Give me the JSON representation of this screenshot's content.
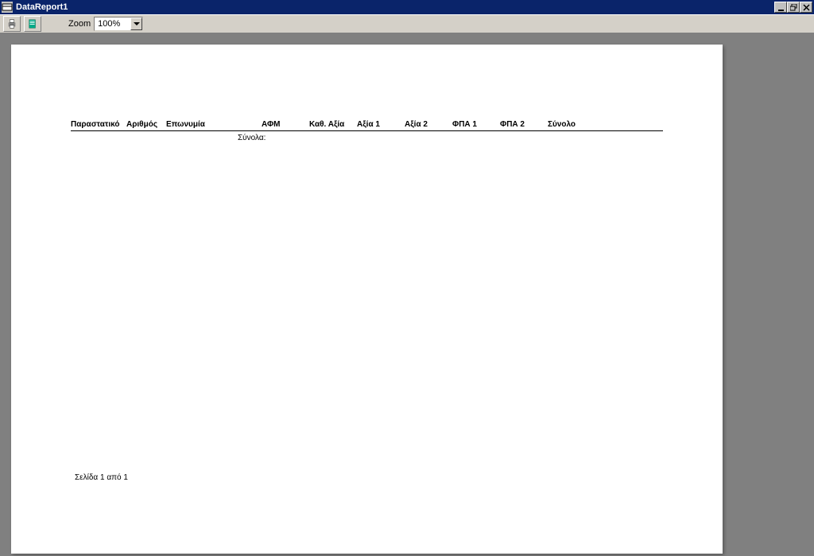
{
  "window": {
    "title": "DataReport1"
  },
  "toolbar": {
    "zoom_label": "Zoom",
    "zoom_value": "100%"
  },
  "report": {
    "columns": {
      "parastatiko": "Παραστατικό",
      "arithmos": "Αριθμός",
      "eponymia": "Επωνυμία",
      "afm": "ΑΦΜ",
      "kathaxia": "Καθ. Αξία",
      "axia1": "Αξία 1",
      "axia2": "Αξία 2",
      "fpa1": "ΦΠΑ 1",
      "fpa2": "ΦΠΑ 2",
      "sinolo": "Σύνολο"
    },
    "totals_label": "Σύνολα:",
    "footer": "Σελίδα 1 από 1"
  }
}
